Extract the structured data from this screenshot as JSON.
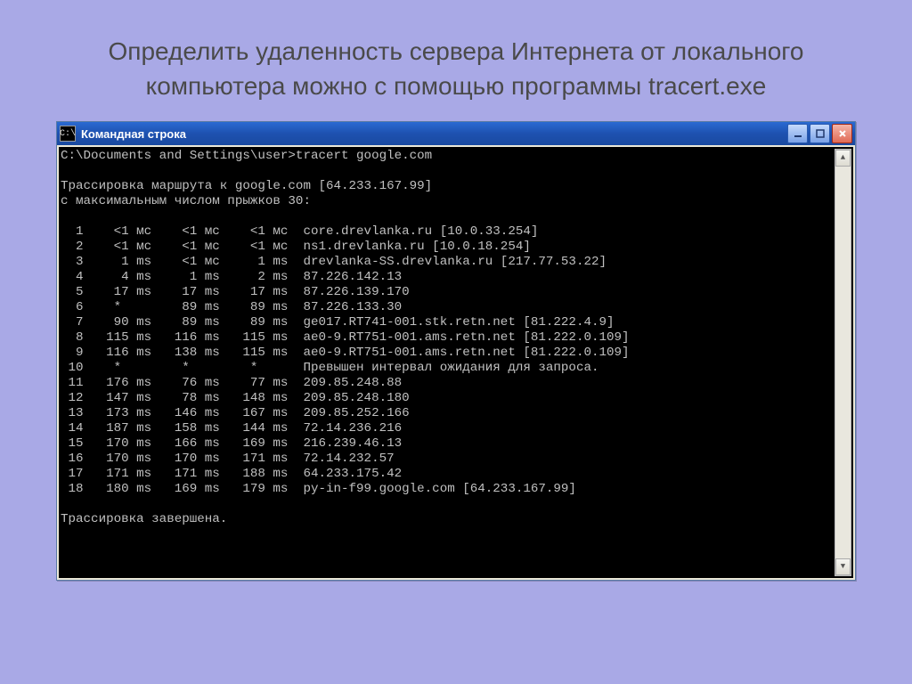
{
  "slide_title": "Определить удаленность сервера Интернета от локального компьютера можно с помощью программы tracert.exe",
  "window": {
    "icon_label": "C:\\",
    "title": "Командная строка"
  },
  "console": {
    "prompt": "C:\\Documents and Settings\\user>tracert google.com",
    "trace_line1": "Трассировка маршрута к google.com [64.233.167.99]",
    "trace_line2": "с максимальным числом прыжков 30:",
    "done": "Трассировка завершена.",
    "hops": [
      {
        "n": "1",
        "a": "<1 мс",
        "b": "<1 мс",
        "c": "<1 мс",
        "host": "core.drevlanka.ru [10.0.33.254]"
      },
      {
        "n": "2",
        "a": "<1 мс",
        "b": "<1 мс",
        "c": "<1 мс",
        "host": "ns1.drevlanka.ru [10.0.18.254]"
      },
      {
        "n": "3",
        "a": "1 ms",
        "b": "<1 мс",
        "c": "1 ms",
        "host": "drevlanka-SS.drevlanka.ru [217.77.53.22]"
      },
      {
        "n": "4",
        "a": "4 ms",
        "b": "1 ms",
        "c": "2 ms",
        "host": "87.226.142.13"
      },
      {
        "n": "5",
        "a": "17 ms",
        "b": "17 ms",
        "c": "17 ms",
        "host": "87.226.139.170"
      },
      {
        "n": "6",
        "a": "*",
        "b": "89 ms",
        "c": "89 ms",
        "host": "87.226.133.30"
      },
      {
        "n": "7",
        "a": "90 ms",
        "b": "89 ms",
        "c": "89 ms",
        "host": "ge017.RT741-001.stk.retn.net [81.222.4.9]"
      },
      {
        "n": "8",
        "a": "115 ms",
        "b": "116 ms",
        "c": "115 ms",
        "host": "ae0-9.RT751-001.ams.retn.net [81.222.0.109]"
      },
      {
        "n": "9",
        "a": "116 ms",
        "b": "138 ms",
        "c": "115 ms",
        "host": "ae0-9.RT751-001.ams.retn.net [81.222.0.109]"
      },
      {
        "n": "10",
        "a": "*",
        "b": "*",
        "c": "*",
        "host": "Превышен интервал ожидания для запроса."
      },
      {
        "n": "11",
        "a": "176 ms",
        "b": "76 ms",
        "c": "77 ms",
        "host": "209.85.248.88"
      },
      {
        "n": "12",
        "a": "147 ms",
        "b": "78 ms",
        "c": "148 ms",
        "host": "209.85.248.180"
      },
      {
        "n": "13",
        "a": "173 ms",
        "b": "146 ms",
        "c": "167 ms",
        "host": "209.85.252.166"
      },
      {
        "n": "14",
        "a": "187 ms",
        "b": "158 ms",
        "c": "144 ms",
        "host": "72.14.236.216"
      },
      {
        "n": "15",
        "a": "170 ms",
        "b": "166 ms",
        "c": "169 ms",
        "host": "216.239.46.13"
      },
      {
        "n": "16",
        "a": "170 ms",
        "b": "170 ms",
        "c": "171 ms",
        "host": "72.14.232.57"
      },
      {
        "n": "17",
        "a": "171 ms",
        "b": "171 ms",
        "c": "188 ms",
        "host": "64.233.175.42"
      },
      {
        "n": "18",
        "a": "180 ms",
        "b": "169 ms",
        "c": "179 ms",
        "host": "py-in-f99.google.com [64.233.167.99]"
      }
    ]
  }
}
